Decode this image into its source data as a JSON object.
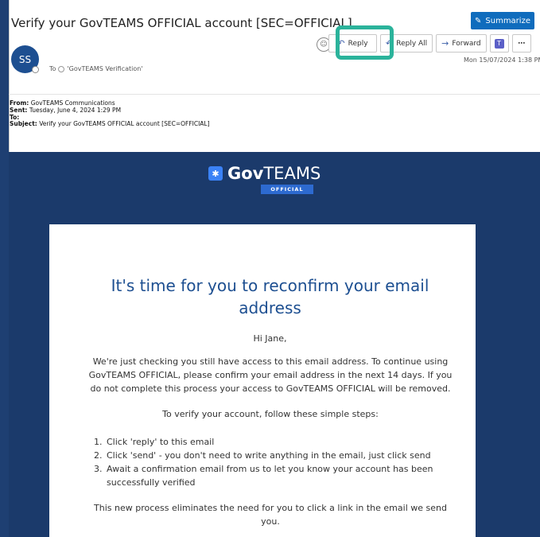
{
  "email": {
    "subject": "Verify your GovTEAMS OFFICIAL account [SEC=OFFICIAL]",
    "summarize_label": "Summarize",
    "avatar_initials": "SS",
    "to_label": "To",
    "to_recipient": "'GovTEAMS Verification'",
    "date": "Mon 15/07/2024 1:38 PM",
    "actions": {
      "reply": "Reply",
      "reply_all": "Reply All",
      "forward": "Forward"
    }
  },
  "forwarded": {
    "from_label": "From:",
    "from_value": "GovTEAMS Communications",
    "sent_label": "Sent:",
    "sent_value": "Tuesday, June 4, 2024 1:29 PM",
    "to_label": "To:",
    "subject_label": "Subject:",
    "subject_value": "Verify your GovTEAMS OFFICIAL account [SEC=OFFICIAL]"
  },
  "body": {
    "logo_gov": "Gov",
    "logo_teams": "TEAMS",
    "logo_tag": "OFFICIAL",
    "title_line1": "It's time for you to reconfirm your email",
    "title_line2": "address",
    "greeting": "Hi Jane,",
    "intro_lines": [
      "We're just checking you still have access to this email address. To continue using",
      "GovTEAMS OFFICIAL, please confirm your email address in the next 14 days. If you",
      "do not complete this process your access to GovTEAMS OFFICIAL will be removed."
    ],
    "steps_intro": "To verify your account, follow these simple steps:",
    "steps": [
      {
        "num": "1.",
        "lines": [
          "Click 'reply' to this email"
        ]
      },
      {
        "num": "2.",
        "lines": [
          "Click 'send' - you don't need to write anything in the email, just click send"
        ]
      },
      {
        "num": "3.",
        "lines": [
          "Await a confirmation email from us to let you know your account has been",
          "successfully verified"
        ]
      }
    ],
    "closing_lines": [
      "This new process eliminates the need for you to click a link in the email we send",
      "you."
    ]
  },
  "colors": {
    "page_bg": "#1b3a6b",
    "highlight": "#2bb39b",
    "summarize": "#0f6cbd",
    "title": "#1d4f91"
  }
}
